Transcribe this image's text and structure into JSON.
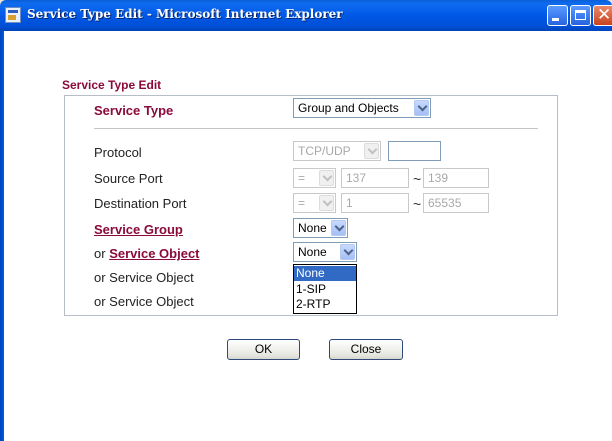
{
  "window": {
    "title": "Service Type Edit - Microsoft Internet Explorer"
  },
  "form": {
    "heading": "Service Type Edit",
    "service_type": {
      "label": "Service Type",
      "value": "Group and Objects"
    },
    "protocol": {
      "label": "Protocol",
      "value": "TCP/UDP",
      "number": ""
    },
    "source_port": {
      "label": "Source Port",
      "operator": "=",
      "start": "137",
      "tilde": "~",
      "end": "139"
    },
    "destination_port": {
      "label": "Destination Port",
      "operator": "=",
      "start": "1",
      "tilde": "~",
      "end": "65535"
    },
    "service_group": {
      "label": "Service Group",
      "value": "None"
    },
    "service_object_1": {
      "prefix": "or",
      "label": "Service Object",
      "value": "None"
    },
    "service_object_2": {
      "label": "or Service Object"
    },
    "service_object_3": {
      "label": "or Service Object"
    },
    "dropdown": {
      "options": [
        "None",
        "1-SIP",
        "2-RTP"
      ],
      "selected_index": 0
    }
  },
  "buttons": {
    "ok": "OK",
    "close": "Close"
  },
  "colors": {
    "accent_label": "#8a0a3a",
    "selection": "#316ac5",
    "titlebar": "#0058e6"
  }
}
